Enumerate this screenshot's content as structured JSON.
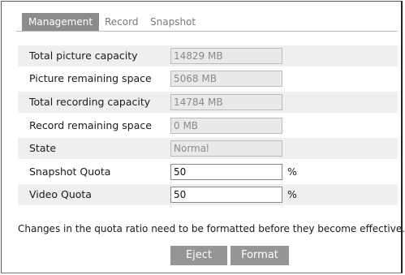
{
  "tabs": [
    {
      "label": "Management",
      "active": true
    },
    {
      "label": "Record",
      "active": false
    },
    {
      "label": "Snapshot",
      "active": false
    }
  ],
  "rows": {
    "total_picture_capacity": {
      "label": "Total picture capacity",
      "value": "14829 MB"
    },
    "picture_remaining_space": {
      "label": "Picture remaining space",
      "value": "5068 MB"
    },
    "total_recording_capacity": {
      "label": "Total recording capacity",
      "value": "14784 MB"
    },
    "record_remaining_space": {
      "label": "Record remaining space",
      "value": "0 MB"
    },
    "state": {
      "label": "State",
      "value": "Normal"
    },
    "snapshot_quota": {
      "label": "Snapshot Quota",
      "value": "50",
      "unit": "%"
    },
    "video_quota": {
      "label": "Video Quota",
      "value": "50",
      "unit": "%"
    }
  },
  "note": "Changes in the quota ratio need to be formatted before they become effective.",
  "buttons": {
    "eject": "Eject",
    "format": "Format"
  },
  "colors": {
    "active_tab_bg": "#8c8c8c",
    "button_bg": "#959595",
    "shaded_row_bg": "#efefef",
    "readonly_field_bg": "#e9e9e9"
  }
}
